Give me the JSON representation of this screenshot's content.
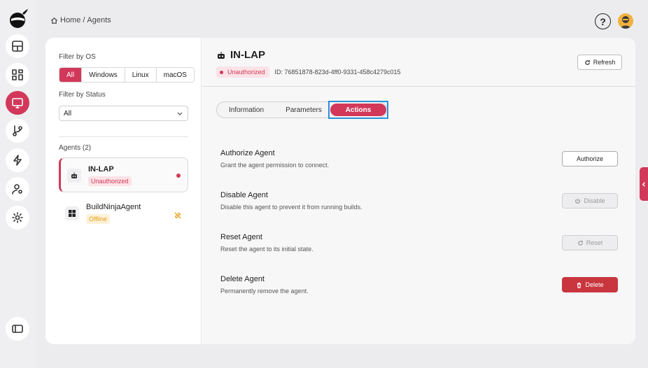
{
  "breadcrumb": {
    "home": "Home",
    "sep": "/",
    "current": "Agents"
  },
  "help": {
    "label": "?"
  },
  "filters": {
    "os_label": "Filter by OS",
    "os_options": [
      "All",
      "Windows",
      "Linux",
      "macOS"
    ],
    "os_selected": "All",
    "status_label": "Filter by Status",
    "status_value": "All"
  },
  "agents_list": {
    "heading": "Agents (2)",
    "items": [
      {
        "name": "IN-LAP",
        "status": "Unauthorized",
        "icon": "robot-icon",
        "state_icon": "red-dot"
      },
      {
        "name": "BuildNinjaAgent",
        "status": "Offline",
        "icon": "windows-icon",
        "state_icon": "link-off-icon"
      }
    ]
  },
  "detail": {
    "title": "IN-LAP",
    "status": "Unauthorized",
    "id_text": "ID: 76851878-823d-4ff0-9331-458c4279c015",
    "refresh_label": "Refresh",
    "tabs": [
      "Information",
      "Parameters",
      "Actions"
    ],
    "active_tab": "Actions",
    "actions": [
      {
        "title": "Authorize Agent",
        "desc": "Grant the agent permission to connect.",
        "button": "Authorize",
        "state": "normal"
      },
      {
        "title": "Disable Agent",
        "desc": "Disable this agent to prevent it from running builds.",
        "button": "Disable",
        "state": "disabled"
      },
      {
        "title": "Reset Agent",
        "desc": "Reset the agent to its initial state.",
        "button": "Reset",
        "state": "disabled"
      },
      {
        "title": "Delete Agent",
        "desc": "Permanently remove the agent.",
        "button": "Delete",
        "state": "danger"
      }
    ]
  },
  "colors": {
    "accent": "#d2385a",
    "danger": "#c9363e",
    "focus": "#2b8fd6",
    "offline": "#e3a21a"
  }
}
